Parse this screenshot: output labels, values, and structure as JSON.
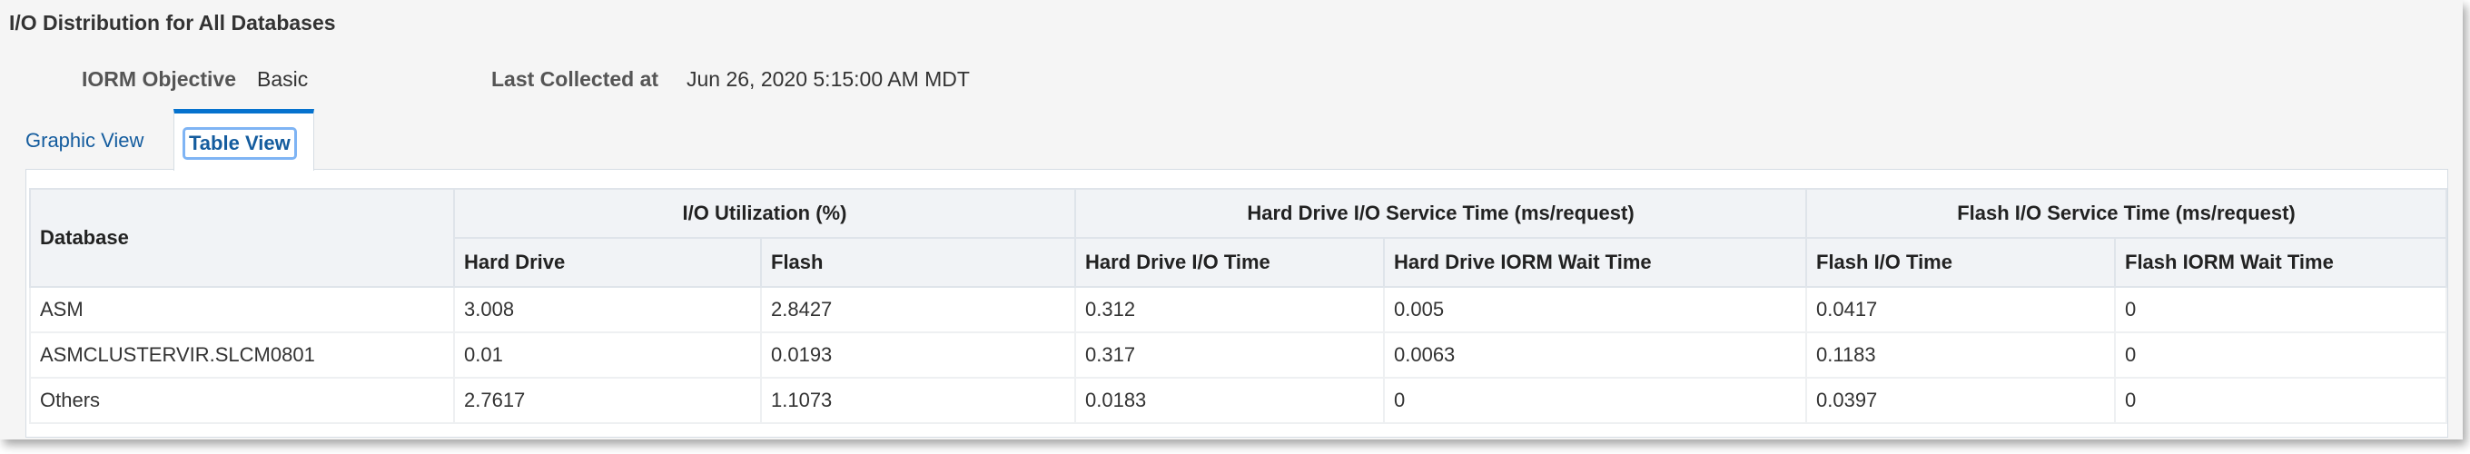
{
  "title": "I/O Distribution for All Databases",
  "iorm_objective": {
    "label": "IORM Objective",
    "value": "Basic"
  },
  "last_collected": {
    "label": "Last Collected at",
    "value": "Jun 26, 2020 5:15:00 AM MDT"
  },
  "tabs": [
    {
      "label": "Graphic View",
      "selected": false
    },
    {
      "label": "Table View",
      "selected": true
    }
  ],
  "table": {
    "database_header": "Database",
    "groups": [
      "I/O Utilization (%)",
      "Hard Drive I/O Service Time (ms/request)",
      "Flash I/O Service Time (ms/request)"
    ],
    "columns": [
      "Hard Drive",
      "Flash",
      "Hard Drive I/O Time",
      "Hard Drive IORM Wait Time",
      "Flash I/O Time",
      "Flash IORM Wait Time"
    ],
    "rows": [
      [
        "ASM",
        "3.008",
        "2.8427",
        "0.312",
        "0.005",
        "0.0417",
        "0"
      ],
      [
        "ASMCLUSTERVIR.SLCM0801",
        "0.01",
        "0.0193",
        "0.317",
        "0.0063",
        "0.1183",
        "0"
      ],
      [
        "Others",
        "2.7617",
        "1.1073",
        "0.0183",
        "0",
        "0.0397",
        "0"
      ]
    ]
  }
}
